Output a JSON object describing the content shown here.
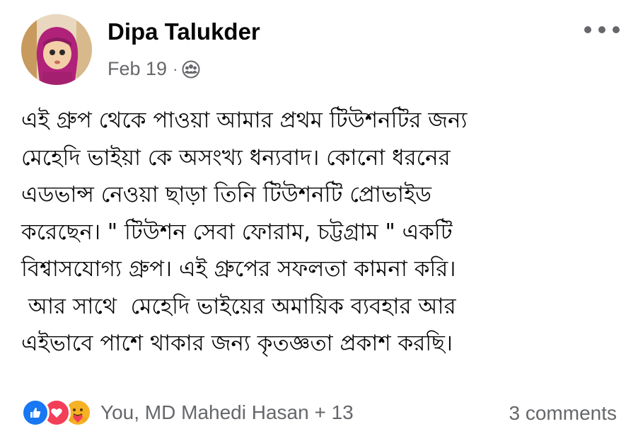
{
  "post": {
    "author": "Dipa Talukder",
    "date": "Feb 19",
    "separator": "·",
    "privacy_icon": "group-members-icon",
    "body_lines": [
      "এই গ্রুপ থেকে পাওয়া আমার প্রথম টিউশনটির জন্য",
      "মেহেদি ভাইয়া কে অসংখ্য ধন্যবাদ। কোনো ধরনের",
      "এডভান্স নেওয়া ছাড়া তিনি টিউশনটি প্রোভাইড",
      "করেছেন। \" টিউশন সেবা ফোরাম, চট্টগ্রাম \" একটি",
      "বিশ্বাসযোগ্য গ্রুপ। এই গ্রুপের সফলতা কামনা করি।",
      " আর সাথে  মেহেদি ভাইয়ের অমায়িক ব্যবহার আর",
      "এইভাবে পাশে থাকার জন্য কৃতজ্ঞতা প্রকাশ করছি।"
    ]
  },
  "reactions": {
    "icons": [
      "like-icon",
      "love-icon",
      "care-icon"
    ],
    "summary": "You, MD Mahedi Hasan + 13"
  },
  "comments_label": "3 comments",
  "colors": {
    "text": "#050505",
    "secondary": "#65676b",
    "like": "#1877f2",
    "love": "#f33e58",
    "care": "#f7b125"
  }
}
